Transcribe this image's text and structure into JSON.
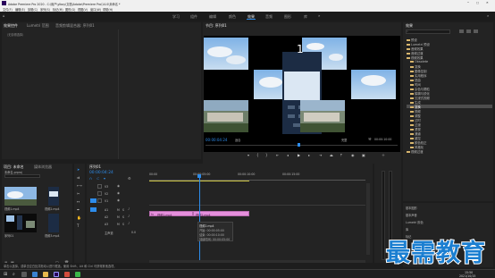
{
  "titlebar": {
    "title": "Adobe Premiere Pro 2020 - C:\\用户\\ylboy\\文档\\Adobe\\Premiere Pro\\14.0\\未命名 *"
  },
  "menubar": {
    "items": [
      "文件(F)",
      "编辑(E)",
      "剪辑(C)",
      "序列(S)",
      "标记(M)",
      "图形(G)",
      "视图(V)",
      "窗口(W)",
      "帮助(H)"
    ]
  },
  "workspaces": {
    "items": [
      "学习",
      "组件",
      "编辑",
      "颜色",
      "效果",
      "音频",
      "图形",
      "库"
    ],
    "active_index": 4
  },
  "source_panel": {
    "tabs": [
      "效果控件",
      "Lumetri 范围",
      "音频剪辑混合器: 序列01"
    ],
    "empty_note": "（无剪辑选择）"
  },
  "program_monitor": {
    "title": "节目: 序列01",
    "timecode_left": "00:00:04:24",
    "fit_label": "适合",
    "quality_label": "完整",
    "timecode_right": "00:00:10:00",
    "digit": "1"
  },
  "effects_panel": {
    "title": "效果",
    "search_placeholder": "",
    "items": [
      "预设",
      "Lumetri 预设",
      "音频效果",
      "音频过渡",
      "视频效果",
      "Obsolete",
      "变换",
      "图像控制",
      "实用程序",
      "扭曲",
      "时间",
      "杂色与颗粒",
      "模糊与锐化",
      "沉浸式视频",
      "生成",
      "视频",
      "调整",
      "过时",
      "过渡",
      "透视",
      "通道",
      "键控",
      "颜色校正",
      "风格化",
      "视频过渡"
    ],
    "selected": "变换"
  },
  "project_panel": {
    "tabs": [
      "项目: 未命名",
      "媒体浏览器"
    ],
    "project_name": "未命名.prproj",
    "items": [
      "视频1.mp4",
      "视频2.mp4",
      "序列01",
      "视频3.mp4"
    ]
  },
  "timeline": {
    "title": "序列01",
    "timecode": "00:00:04:24",
    "ruler": [
      "00:00",
      "00:00:05:00",
      "00:00:10:00",
      "00:00:15:00"
    ],
    "tracks": [
      "V3",
      "V2",
      "V1",
      "A1",
      "A2",
      "A3"
    ],
    "master": "主声道",
    "master_value": "0.0",
    "clips": [
      "视频1.mp4",
      "视频2.mp4"
    ],
    "tooltip": {
      "name": "视频2.mp4",
      "start": "开始: 00:00:05:00",
      "end": "结束: 00:00:10:00",
      "duration": "持续时间: 00:00:05:00"
    }
  },
  "libraries_panel": {
    "items": [
      "基本图形",
      "基本声音",
      "Lumetri 颜色",
      "库",
      "标记"
    ]
  },
  "statusbar": {
    "text": "单击以选择，或单击空白处并拖动以进行框选。使用 Shift、Alt 和 Ctrl 可获得其他选项。"
  },
  "watermark": {
    "text": "最需教育"
  },
  "clock": {
    "time": "15:50",
    "date": "2021/10/15"
  },
  "colors": {
    "clip": "#e58fdc",
    "accent": "#2d8ceb",
    "selection": "#4d4d4d",
    "playhead": "#2d8ceb",
    "watermark": "#1b7fd1"
  }
}
